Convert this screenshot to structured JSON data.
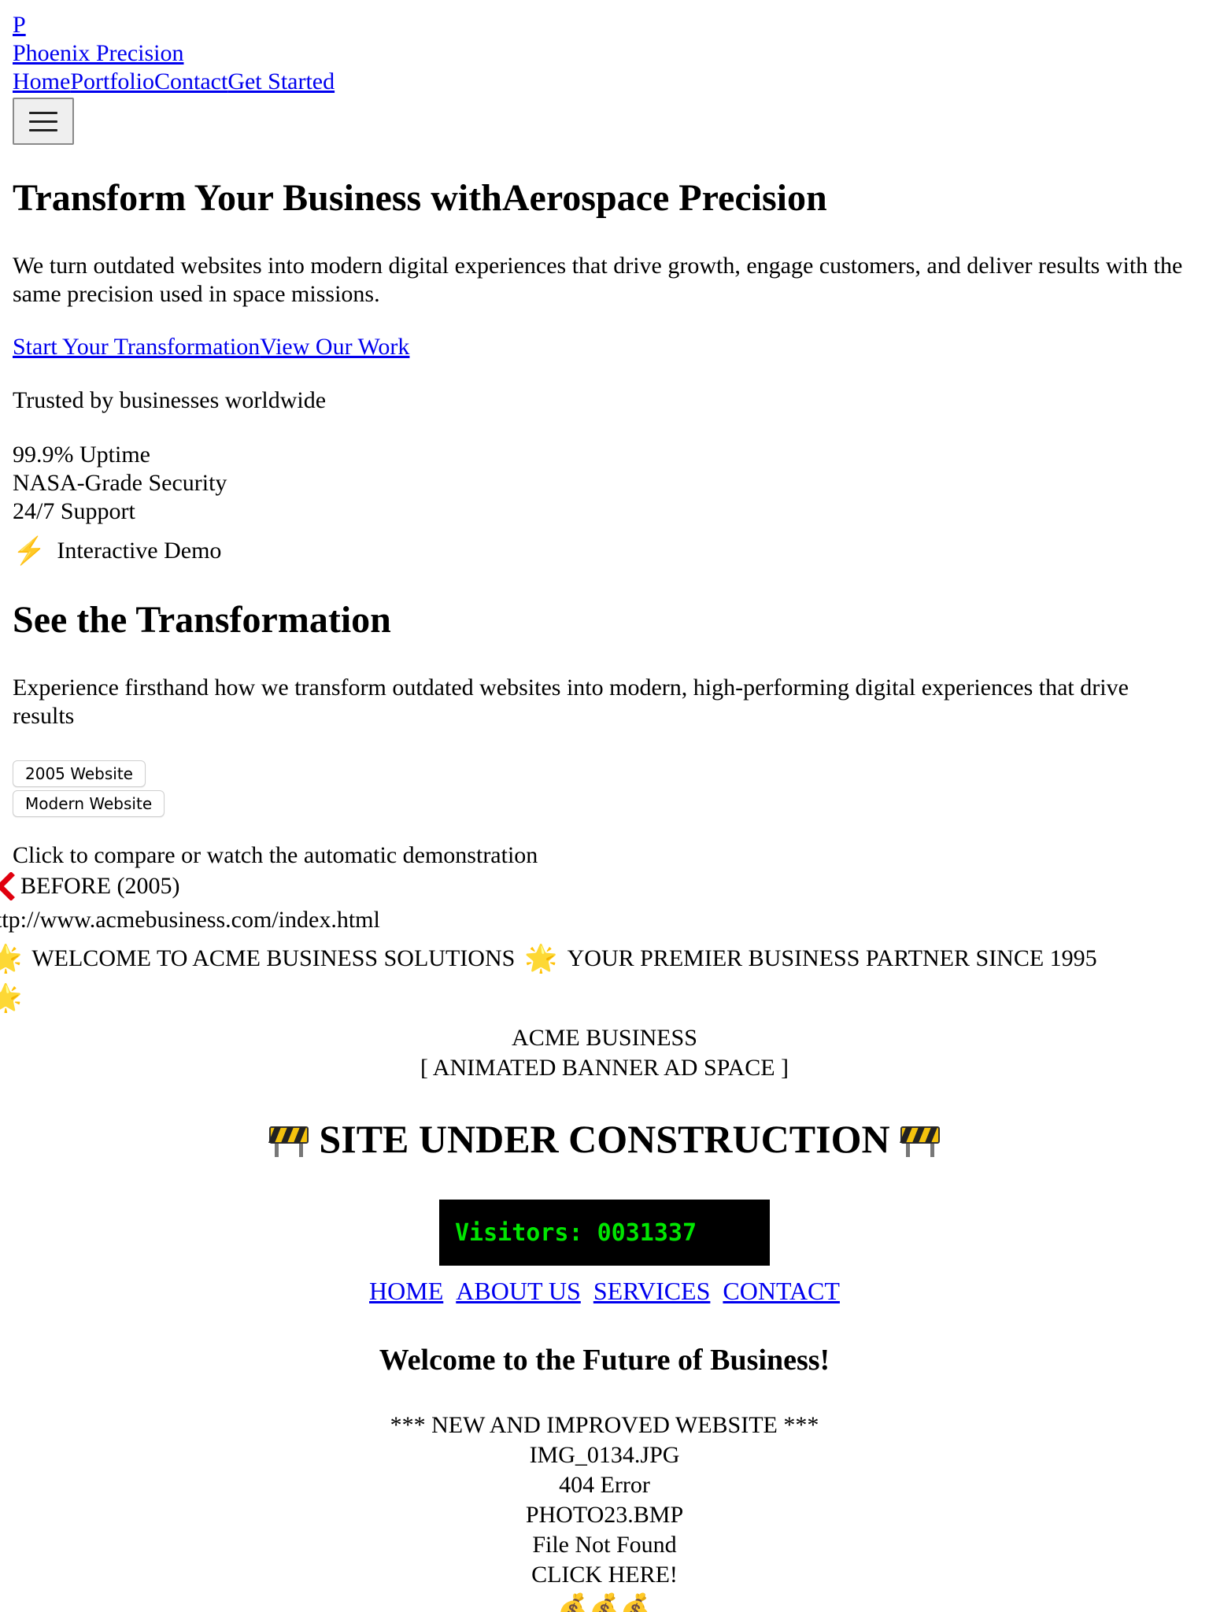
{
  "modern_nav": {
    "logo_letter": "P",
    "brand": "Phoenix Precision",
    "links": [
      "Home",
      "Portfolio",
      "Contact",
      "Get Started"
    ]
  },
  "hero": {
    "title": "Transform Your Business withAerospace Precision",
    "subtitle": "We turn outdated websites into modern digital experiences that drive growth, engage customers, and deliver results with the same precision used in space missions.",
    "cta_primary": "Start Your Transformation",
    "cta_secondary": "View Our Work",
    "trusted": "Trusted by businesses worldwide",
    "stats": [
      "99.9% Uptime",
      "NASA-Grade Security",
      "24/7 Support"
    ],
    "demo_label": "Interactive Demo"
  },
  "transformation": {
    "title": "See the Transformation",
    "subtitle": "Experience firsthand how we transform outdated websites into modern, high-performing digital experiences that drive results",
    "btn_old": "2005 Website",
    "btn_new": "Modern Website",
    "hint": "Click to compare or watch the automatic demonstration",
    "before_label": "BEFORE (2005)"
  },
  "retro_site": {
    "url": "ttp://www.acmebusiness.com/index.html",
    "marquee_a": "WELCOME TO ACME BUSINESS SOLUTIONS",
    "marquee_b": "YOUR PREMIER BUSINESS PARTNER SINCE 1995",
    "banner_title": "ACME BUSINESS",
    "banner_ad": "[ ANIMATED BANNER AD SPACE ]",
    "construction": "SITE UNDER CONSTRUCTION",
    "counter": "Visitors: 0031337",
    "nav": [
      "HOME",
      "ABOUT US",
      "SERVICES",
      "CONTACT"
    ],
    "welcome": "Welcome to the Future of Business!",
    "items": [
      "*** NEW AND IMPROVED WEBSITE ***",
      "IMG_0134.JPG",
      "404 Error",
      "PHOTO23.BMP",
      "File Not Found",
      "CLICK HERE!"
    ],
    "bags": "💰💰💰"
  },
  "colors": {
    "link": "#0000ee",
    "counter_bg": "#000000",
    "counter_text": "#00e600",
    "chevron": "#e0000e"
  },
  "icons": {
    "menu": "hamburger-icon",
    "demo": "lightning-icon",
    "before": "chevron-left-icon",
    "marquee": "star-icon",
    "construction": "barrier-icon",
    "bags": "money-bag-icon"
  }
}
